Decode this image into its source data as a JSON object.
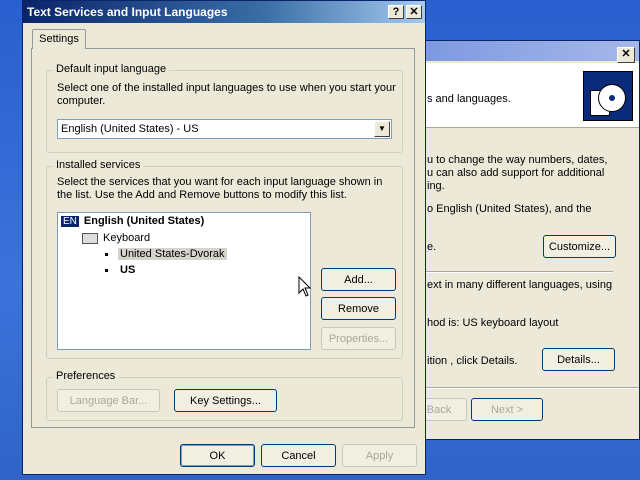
{
  "dialog": {
    "title": "Text Services and Input Languages",
    "help_btn": "?",
    "close_btn": "✕",
    "tab": "Settings",
    "default_input": {
      "legend": "Default input language",
      "desc": "Select one of the installed input languages to use when you start your computer.",
      "selected": "English (United States) - US"
    },
    "installed": {
      "legend": "Installed services",
      "desc": "Select the services that you want for each input language shown in the list. Use the Add and Remove buttons to modify this list.",
      "tree": {
        "lang_badge": "EN",
        "lang": "English (United States)",
        "category": "Keyboard",
        "items": [
          "United States-Dvorak",
          "US"
        ]
      },
      "add": "Add...",
      "remove": "Remove",
      "properties": "Properties..."
    },
    "preferences": {
      "legend": "Preferences",
      "language_bar": "Language Bar...",
      "key_settings": "Key Settings..."
    },
    "ok": "OK",
    "cancel": "Cancel",
    "apply": "Apply"
  },
  "background_window": {
    "close_btn": "✕",
    "header_text": "s and languages.",
    "p1_l1": "u to change the way numbers, dates,",
    "p1_l2": "u can also add support for additional",
    "p1_l3": "ing.",
    "p2_l1": "o English (United States), and the",
    "p2_l2": "e.",
    "customize": "Customize...",
    "p3_l1": "ext in many different languages, using",
    "p3_l2": "hod is: US keyboard layout",
    "p3_l3": "ition , click Details.",
    "details": "Details...",
    "back": "Back",
    "next": "Next >"
  }
}
